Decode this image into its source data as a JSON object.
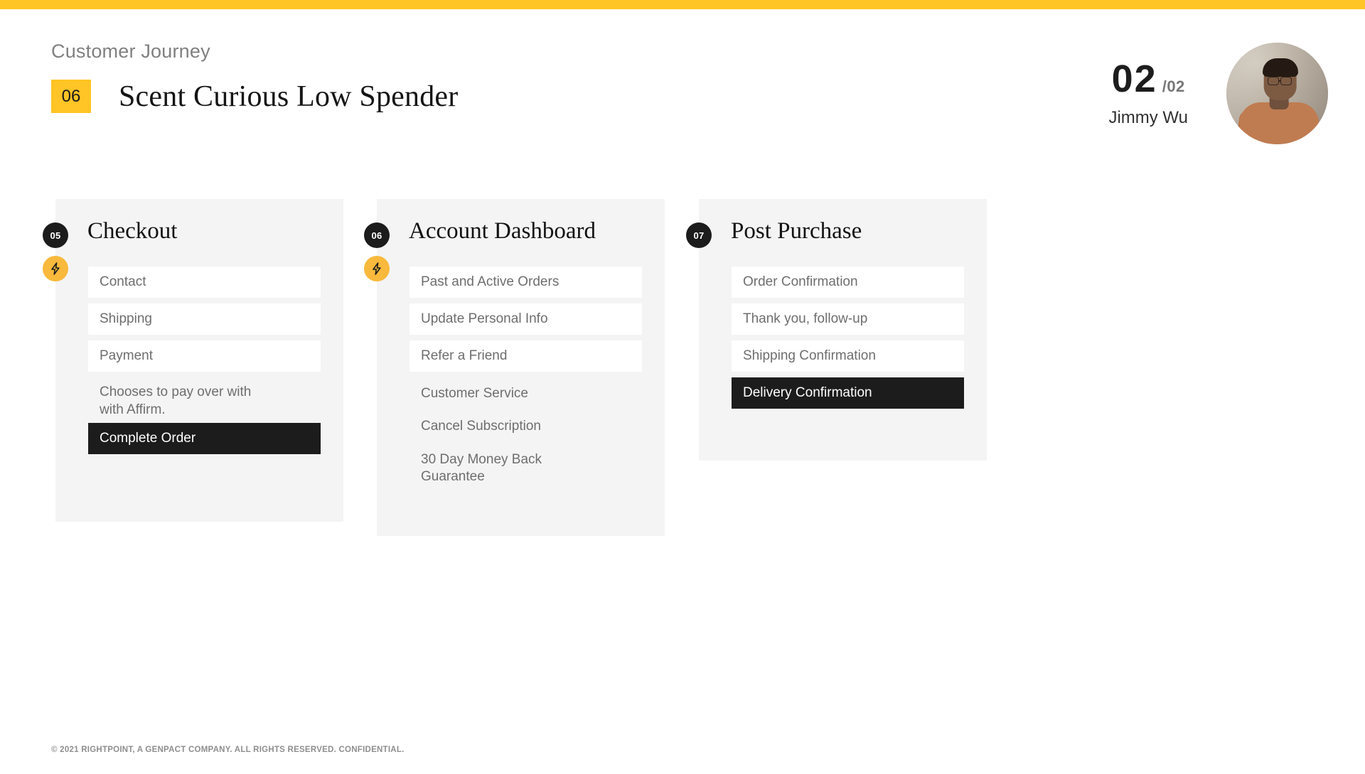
{
  "brand": {
    "accent_yellow": "#FFC425",
    "bolt_yellow": "#F8B93C",
    "dark": "#1c1c1c",
    "card_bg": "#F4F4F4"
  },
  "header": {
    "eyebrow": "Customer Journey",
    "slide_number_chip": "06",
    "title": "Scent Curious Low Spender",
    "page_current": "02",
    "page_total": "/02",
    "presenter_name": "Jimmy Wu",
    "avatar_icon": "person-avatar-photo"
  },
  "cards": [
    {
      "step": "05",
      "title": "Checkout",
      "has_bolt": true,
      "bolt_icon": "lightning-bolt-icon",
      "rows": [
        {
          "label": "Contact",
          "style": "light"
        },
        {
          "label": "Shipping",
          "style": "light"
        },
        {
          "label": "Payment",
          "style": "light"
        }
      ],
      "note": "Chooses to pay over with with Affirm.",
      "plain_items": [],
      "cta": {
        "label": "Complete Order",
        "style": "dark"
      }
    },
    {
      "step": "06",
      "title": "Account Dashboard",
      "has_bolt": true,
      "bolt_icon": "lightning-bolt-icon",
      "rows": [
        {
          "label": "Past and Active Orders",
          "style": "light"
        },
        {
          "label": "Update Personal Info",
          "style": "light"
        },
        {
          "label": "Refer a Friend",
          "style": "light"
        }
      ],
      "note": "",
      "plain_items": [
        "Customer Service",
        "Cancel Subscription",
        "30 Day Money Back Guarantee"
      ],
      "cta": null
    },
    {
      "step": "07",
      "title": "Post Purchase",
      "has_bolt": false,
      "bolt_icon": "",
      "rows": [
        {
          "label": "Order Confirmation",
          "style": "light"
        },
        {
          "label": "Thank you, follow-up",
          "style": "light"
        },
        {
          "label": "Shipping Confirmation",
          "style": "light"
        }
      ],
      "note": "",
      "plain_items": [],
      "cta": {
        "label": "Delivery Confirmation",
        "style": "dark"
      }
    }
  ],
  "footer": {
    "copyright": "© 2021 RIGHTPOINT, A GENPACT COMPANY. ALL RIGHTS RESERVED. CONFIDENTIAL."
  }
}
